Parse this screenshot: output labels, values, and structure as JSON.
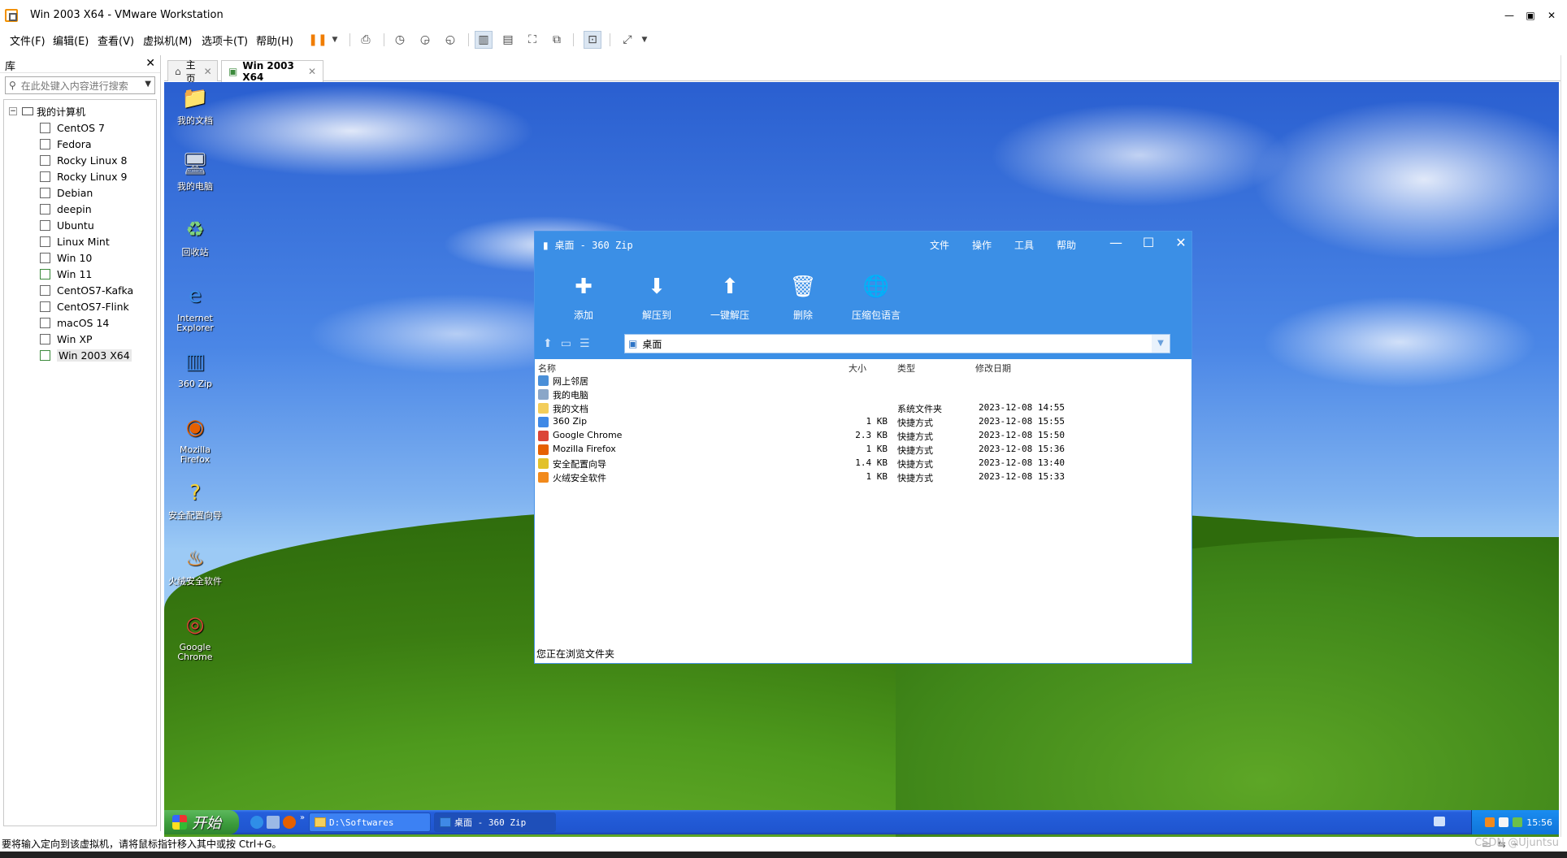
{
  "host": {
    "title": "Win 2003 X64 - VMware Workstation",
    "menu": [
      "文件(F)",
      "编辑(E)",
      "查看(V)",
      "虚拟机(M)",
      "选项卡(T)",
      "帮助(H)"
    ],
    "status_text": "要将输入定向到该虚拟机，请将鼠标指针移入其中或按 Ctrl+G。",
    "watermark": "CSDN @Ujuntsu"
  },
  "library": {
    "title": "库",
    "search_placeholder": "在此处键入内容进行搜索",
    "root": "我的计算机",
    "vms": [
      "CentOS 7",
      "Fedora",
      "Rocky Linux 8",
      "Rocky Linux 9",
      "Debian",
      "deepin",
      "Ubuntu",
      "Linux Mint",
      "Win 10",
      "Win 11",
      "CentOS7-Kafka",
      "CentOS7-Flink",
      "macOS 14",
      "Win XP",
      "Win 2003 X64"
    ]
  },
  "tabs": [
    {
      "label": "主页"
    },
    {
      "label": "Win 2003 X64"
    }
  ],
  "desktop_icons": [
    {
      "label": "我的文档",
      "icon": "folder-documents-icon"
    },
    {
      "label": "我的电脑",
      "icon": "computer-icon"
    },
    {
      "label": "回收站",
      "icon": "recycle-bin-icon"
    },
    {
      "label": "Internet Explorer",
      "icon": "ie-icon"
    },
    {
      "label": "360 Zip",
      "icon": "zip-icon"
    },
    {
      "label": "Mozilla Firefox",
      "icon": "firefox-icon"
    },
    {
      "label": "安全配置向导",
      "icon": "security-wizard-icon"
    },
    {
      "label": "火绒安全软件",
      "icon": "huorong-icon"
    },
    {
      "label": "Google Chrome",
      "icon": "chrome-icon"
    }
  ],
  "zip": {
    "title": "桌面 - 360 Zip",
    "menu": [
      "文件",
      "操作",
      "工具",
      "帮助"
    ],
    "toolbar": [
      "添加",
      "解压到",
      "一键解压",
      "删除",
      "压缩包语言"
    ],
    "address": "桌面",
    "columns": {
      "name": "名称",
      "size": "大小",
      "type": "类型",
      "modified": "修改日期"
    },
    "files": [
      {
        "name": "网上邻居",
        "size": "",
        "type": "",
        "modified": "",
        "color": "#4a8fd8"
      },
      {
        "name": "我的电脑",
        "size": "",
        "type": "",
        "modified": "",
        "color": "#8aa6c8"
      },
      {
        "name": "我的文档",
        "size": "",
        "type": "系统文件夹",
        "modified": "2023-12-08 14:55",
        "color": "#f3cd5a"
      },
      {
        "name": "360 Zip",
        "size": "1 KB",
        "type": "快捷方式",
        "modified": "2023-12-08 15:55",
        "color": "#3f89e6"
      },
      {
        "name": "Google Chrome",
        "size": "2.3 KB",
        "type": "快捷方式",
        "modified": "2023-12-08 15:50",
        "color": "#db4437"
      },
      {
        "name": "Mozilla Firefox",
        "size": "1 KB",
        "type": "快捷方式",
        "modified": "2023-12-08 15:36",
        "color": "#e66000"
      },
      {
        "name": "安全配置向导",
        "size": "1.4 KB",
        "type": "快捷方式",
        "modified": "2023-12-08 13:40",
        "color": "#e2c12a"
      },
      {
        "name": "火绒安全软件",
        "size": "1 KB",
        "type": "快捷方式",
        "modified": "2023-12-08 15:33",
        "color": "#f28a1c"
      }
    ],
    "status": "您正在浏览文件夹"
  },
  "guest_taskbar": {
    "start": "开始",
    "tasks": [
      "D:\\Softwares",
      "桌面 - 360 Zip"
    ],
    "clock": "15:56"
  }
}
